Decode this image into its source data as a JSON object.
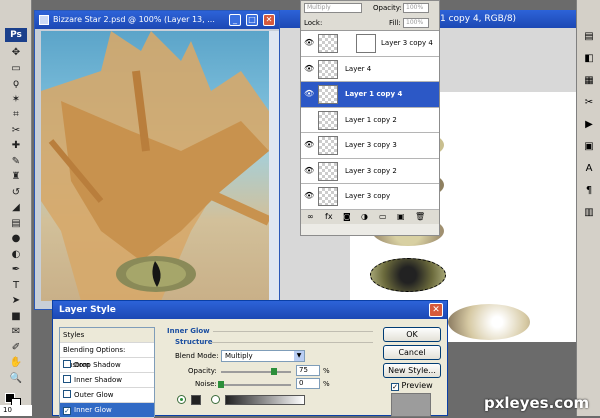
{
  "toolbox": {
    "logo": "Ps",
    "tools": [
      "move-icon",
      "marquee-icon",
      "lasso-icon",
      "magic-wand-icon",
      "crop-icon",
      "slice-icon",
      "healing-icon",
      "brush-icon",
      "stamp-icon",
      "history-brush-icon",
      "eraser-icon",
      "gradient-icon",
      "blur-icon",
      "dodge-icon",
      "pen-icon",
      "type-icon",
      "path-select-icon",
      "shape-icon",
      "notes-icon",
      "eyedropper-icon",
      "hand-icon",
      "zoom-icon"
    ],
    "tool_glyphs": [
      "✥",
      "▭",
      "ϙ",
      "✶",
      "⌗",
      "✂",
      "✚",
      "✎",
      "♜",
      "↺",
      "◢",
      "▤",
      "●",
      "◐",
      "✒",
      "T",
      "➤",
      "■",
      "✉",
      "✐",
      "✋",
      "🔍"
    ],
    "zoom_status": "10"
  },
  "doc_window": {
    "title": "Bizzare Star 2.psd @ 100% (Layer 13, ...",
    "min_glyph": "_",
    "max_glyph": "□",
    "close_glyph": "✕"
  },
  "doc_window2": {
    "title": "1 copy 4, RGB/8)"
  },
  "layers_panel": {
    "blend_mode": "Multiply",
    "opacity_label": "Opacity:",
    "opacity_value": "100%",
    "lock_label": "Lock:",
    "fill_label": "Fill:",
    "fill_value": "100%",
    "layers": [
      {
        "name": "Layer 3 copy 4",
        "visible": true,
        "selected": false,
        "has_mask": true
      },
      {
        "name": "Layer 4",
        "visible": true,
        "selected": false,
        "has_mask": false
      },
      {
        "name": "Layer 1 copy 4",
        "visible": true,
        "selected": true,
        "has_mask": false
      },
      {
        "name": "Layer 1 copy 2",
        "visible": false,
        "selected": false,
        "has_mask": false
      },
      {
        "name": "Layer 3 copy 3",
        "visible": true,
        "selected": false,
        "has_mask": false
      },
      {
        "name": "Layer 3 copy 2",
        "visible": true,
        "selected": false,
        "has_mask": false
      },
      {
        "name": "Layer 3 copy",
        "visible": true,
        "selected": false,
        "has_mask": false
      }
    ],
    "eye_glyph": "👁",
    "footer_icons": [
      "link-layers-icon",
      "layer-style-icon",
      "add-mask-icon",
      "adjustment-layer-icon",
      "new-group-icon",
      "new-layer-icon",
      "delete-layer-icon"
    ],
    "footer_glyphs": [
      "∞",
      "fx",
      "◙",
      "◑",
      "▭",
      "▣",
      "🗑"
    ]
  },
  "right_strip": {
    "icons": [
      "navigator-icon",
      "color-icon",
      "swatches-icon",
      "tools-icon",
      "actions-icon",
      "history-icon",
      "character-icon",
      "paragraph-icon",
      "layer-comps-icon"
    ],
    "glyphs": [
      "▤",
      "◧",
      "▦",
      "✂",
      "▶",
      "▣",
      "A",
      "¶",
      "▥"
    ]
  },
  "layer_style_dialog": {
    "title": "Layer Style",
    "close_glyph": "✕",
    "styles_header": "Styles",
    "list": [
      {
        "label": "Blending Options: Custom",
        "checkbox": false,
        "checked": false,
        "active": false
      },
      {
        "label": "Drop Shadow",
        "checkbox": true,
        "checked": false,
        "active": false
      },
      {
        "label": "Inner Shadow",
        "checkbox": true,
        "checked": false,
        "active": false
      },
      {
        "label": "Outer Glow",
        "checkbox": true,
        "checked": false,
        "active": false
      },
      {
        "label": "Inner Glow",
        "checkbox": true,
        "checked": true,
        "active": true
      }
    ],
    "section_title": "Inner Glow",
    "group_title": "Structure",
    "blend_mode_label": "Blend Mode:",
    "blend_mode_value": "Multiply",
    "opacity_label": "Opacity:",
    "opacity_value": "75",
    "opacity_level": 0.75,
    "noise_label": "Noise:",
    "noise_value": "0",
    "noise_level": 0,
    "percent": "%",
    "ok_label": "OK",
    "cancel_label": "Cancel",
    "new_style_label": "New Style...",
    "preview_label": "Preview",
    "preview_checked": true
  },
  "watermark": "pxleyes.com",
  "colors": {
    "titlebar": "#1c48b4",
    "selection": "#2c58c6",
    "dialog_bg": "#ece9d8"
  }
}
